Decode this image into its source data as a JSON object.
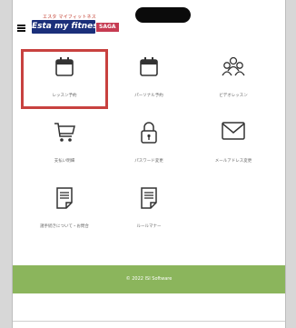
{
  "header": {
    "logo_tagline": "エスタ マイフィットネス",
    "logo_wordmark": "Esta my fitness",
    "logo_city": "SAGA"
  },
  "menu": [
    {
      "label": "レッスン予約",
      "icon": "calendar-icon",
      "selected": true
    },
    {
      "label": "パーソナル予約",
      "icon": "calendar-icon",
      "selected": false
    },
    {
      "label": "ビデオレッスン",
      "icon": "people-icon",
      "selected": false
    },
    {
      "label": "支払い明細",
      "icon": "cart-icon",
      "selected": false
    },
    {
      "label": "パスワード変更",
      "icon": "lock-icon",
      "selected": false
    },
    {
      "label": "メールアドレス変更",
      "icon": "mail-icon",
      "selected": false
    },
    {
      "label": "諸手続きについて・お問合",
      "icon": "document-icon",
      "selected": false
    },
    {
      "label": "ルールマナー",
      "icon": "document-icon",
      "selected": false
    }
  ],
  "footer": {
    "copyright": "© 2022 ISI Software"
  },
  "colors": {
    "accent_selection": "#c8413f",
    "footer_bg": "#8bb55c",
    "logo_bg": "#1b2f7a"
  }
}
